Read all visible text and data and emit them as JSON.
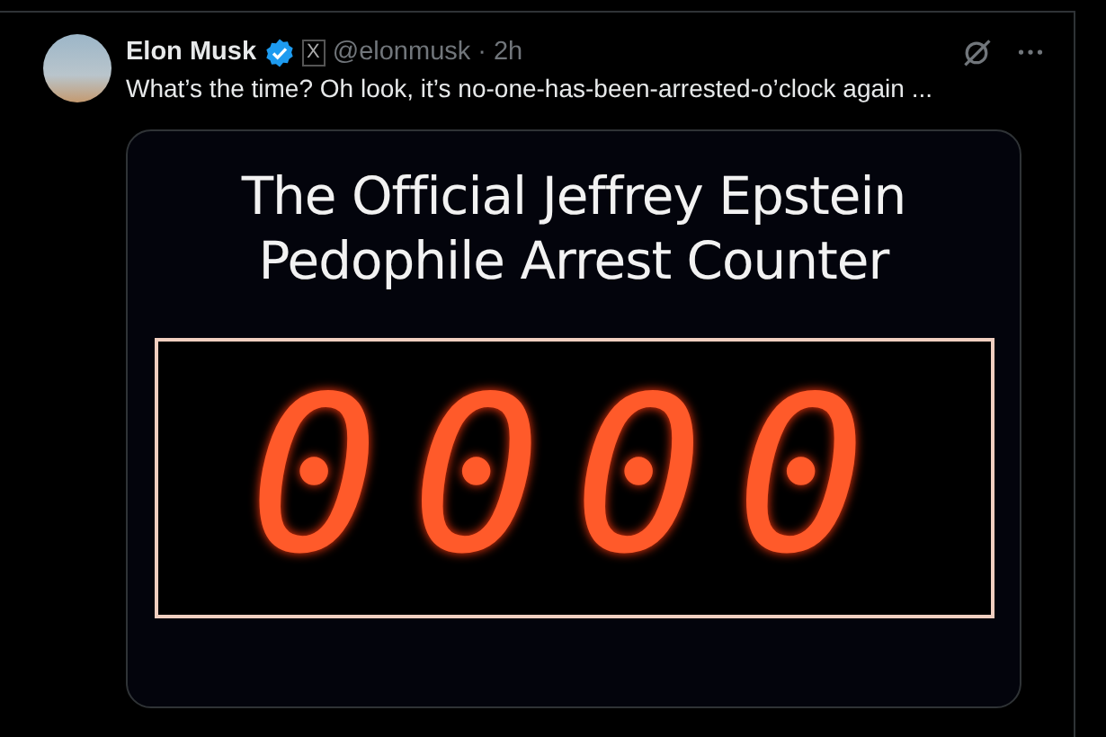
{
  "post": {
    "author": "Elon Musk",
    "verified": true,
    "affiliate_badge": "X",
    "handle": "@elonmusk",
    "separator": "·",
    "time": "2h",
    "text": "What’s the time? Oh look, it’s no-one-has-been-arrested-o’clock again ..."
  },
  "image": {
    "title_lines": [
      "The Official Jeffrey Epstein",
      "Pedophile Arrest Counter"
    ],
    "counter": "0000"
  }
}
